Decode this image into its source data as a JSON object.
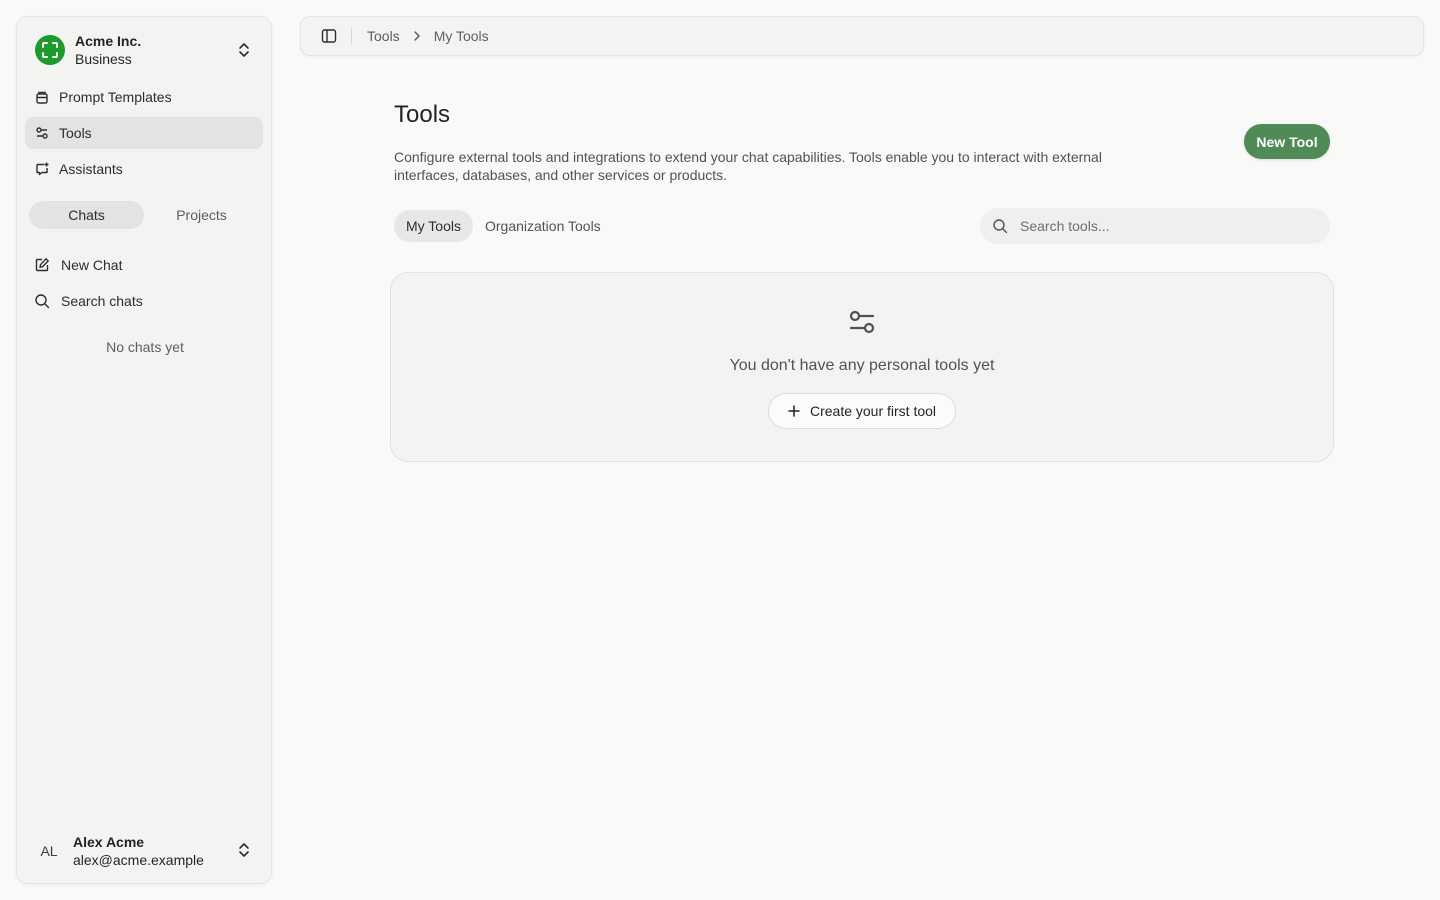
{
  "sidebar": {
    "org": {
      "name": "Acme Inc.",
      "plan": "Business",
      "logo_color": "#1d9a2c"
    },
    "nav": [
      {
        "label": "Prompt Templates",
        "icon": "template-icon",
        "active": false
      },
      {
        "label": "Tools",
        "icon": "tools-sliders-icon",
        "active": true
      },
      {
        "label": "Assistants",
        "icon": "assistant-icon",
        "active": false
      }
    ],
    "segment": {
      "chats": "Chats",
      "projects": "Projects",
      "selected": "Chats"
    },
    "chat_actions": {
      "new_chat": "New Chat",
      "search_chats": "Search chats"
    },
    "empty_chats": "No chats yet",
    "user": {
      "initials": "AL",
      "name": "Alex Acme",
      "email": "alex@acme.example"
    }
  },
  "topbar": {
    "breadcrumb": {
      "parent": "Tools",
      "current": "My Tools"
    }
  },
  "main": {
    "title": "Tools",
    "description": "Configure external tools and integrations to extend your chat capabilities. Tools enable you to interact with external interfaces, databases, and other services or products.",
    "new_tool_label": "New Tool",
    "tabs": {
      "my_tools": "My Tools",
      "org_tools": "Organization Tools",
      "selected": "My Tools"
    },
    "search": {
      "placeholder": "Search tools...",
      "value": ""
    },
    "empty_state": {
      "message": "You don't have any personal tools yet",
      "button_label": "Create your first tool"
    }
  },
  "colors": {
    "accent": "#4f8a57",
    "active_nav": "#e2e4e1"
  }
}
